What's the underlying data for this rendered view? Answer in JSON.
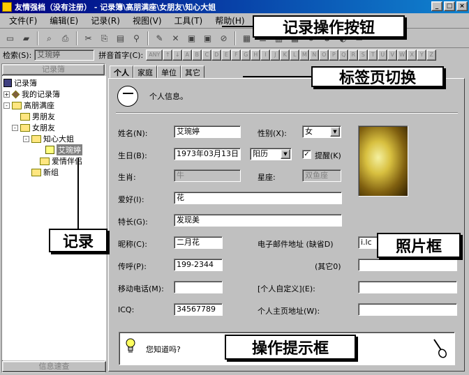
{
  "window": {
    "title": "友情强档（没有注册） - 记录簿\\高朋满座\\女朋友\\知心大姐",
    "controls": [
      "_",
      "□",
      "×"
    ]
  },
  "menu": [
    "文件(F)",
    "编辑(E)",
    "记录(R)",
    "视图(V)",
    "工具(T)",
    "帮助(H)"
  ],
  "search": {
    "label": "检索(S):",
    "value": "艾琬婷",
    "pinyin_label": "拼音首字(C):",
    "alpha_keys": [
      "ANY",
      "↑",
      "↓",
      "A",
      "B",
      "C",
      "D",
      "E",
      "F",
      "G",
      "H",
      "I",
      "J",
      "K",
      "L",
      "M",
      "N",
      "O",
      "P",
      "Q",
      "R",
      "S",
      "T",
      "U",
      "V",
      "W",
      "X",
      "Y",
      "Z"
    ]
  },
  "left_panel": {
    "header": "记录簿",
    "footer": "信息速查",
    "tree": [
      {
        "label": "记录簿",
        "level": 0,
        "icon": "book-icon"
      },
      {
        "label": "我的记录簿",
        "level": 1,
        "icon": "diamond-icon",
        "toggle": "+"
      },
      {
        "label": "高朋满座",
        "level": 1,
        "icon": "folder-icon",
        "toggle": "-"
      },
      {
        "label": "男朋友",
        "level": 2,
        "icon": "folder-icon"
      },
      {
        "label": "女朋友",
        "level": 2,
        "icon": "folder-icon",
        "toggle": "-"
      },
      {
        "label": "知心大姐",
        "level": 3,
        "icon": "folder-icon",
        "toggle": "-"
      },
      {
        "label": "艾琬婷",
        "level": 4,
        "icon": "record-icon",
        "selected": true
      },
      {
        "label": "爱情伴侣",
        "level": 3,
        "icon": "folder-icon"
      },
      {
        "label": "新组",
        "level": 2,
        "icon": "folder-icon"
      }
    ]
  },
  "tabs": [
    "个人",
    "家庭",
    "单位",
    "其它"
  ],
  "form": {
    "info_title": "个人信息。",
    "name_label": "姓名(N):",
    "name_value": "艾琬婷",
    "gender_label": "性别(X):",
    "gender_value": "女",
    "birthday_label": "生日(B):",
    "birthday_value": "1973年03月13日",
    "calendar_value": "阳历",
    "remind_label": "提醒(K)",
    "remind_checked": "✓",
    "zodiac_label": "生肖:",
    "zodiac_value": "牛",
    "constellation_label": "星座:",
    "constellation_value": "双鱼座",
    "hobby_label": "爱好(I):",
    "hobby_value": "花",
    "specialty_label": "特长(G):",
    "specialty_value": "发现美",
    "nickname_label": "昵称(C):",
    "nickname_value": "二月花",
    "email_label": "电子邮件地址 (缺省D)",
    "email_value": "i.lc",
    "pager_label": "传呼(P):",
    "pager_value": "199-2344",
    "other_label": "(其它0)",
    "mobile_label": "移动电话(M):",
    "mobile_value": "",
    "custom_label": "[个人自定义](E):",
    "icq_label": "ICQ:",
    "icq_value": "34567789",
    "homepage_label": "个人主页地址(W):"
  },
  "tip": {
    "text": "您知道吗?"
  },
  "annotations": {
    "record_buttons": "记录操作按钮",
    "tab_switch": "标签页切换",
    "record": "记录",
    "photo_frame": "照片框",
    "tip_box": "操作提示框"
  }
}
